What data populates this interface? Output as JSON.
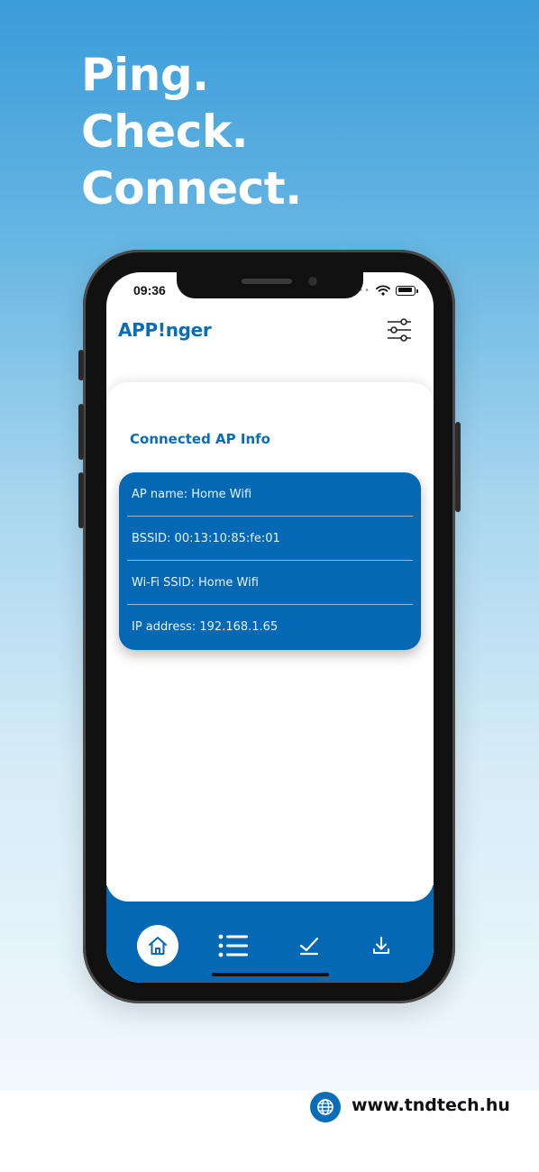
{
  "headline": {
    "line1": "Ping.",
    "line2": "Check.",
    "line3": "Connect."
  },
  "status_bar": {
    "time": "09:36"
  },
  "app": {
    "logo": "APP!nger",
    "settings_icon": "sliders-icon"
  },
  "section": {
    "title": "Connected AP Info"
  },
  "ap_info": [
    "AP name: Home Wifi",
    "BSSID: 00:13:10:85:fe:01",
    "Wi-Fi SSID: Home Wifi",
    "IP address: 192.168.1.65"
  ],
  "tabs": [
    {
      "icon": "home-icon",
      "active": true
    },
    {
      "icon": "list-icon",
      "active": false
    },
    {
      "icon": "check-icon",
      "active": false
    },
    {
      "icon": "download-icon",
      "active": false
    }
  ],
  "footer": {
    "website": "www.tndtech.hu",
    "icon": "globe-icon"
  },
  "colors": {
    "brand_blue": "#0468b5",
    "logo_blue": "#0a6db8",
    "background_top": "#3a9cd9"
  }
}
